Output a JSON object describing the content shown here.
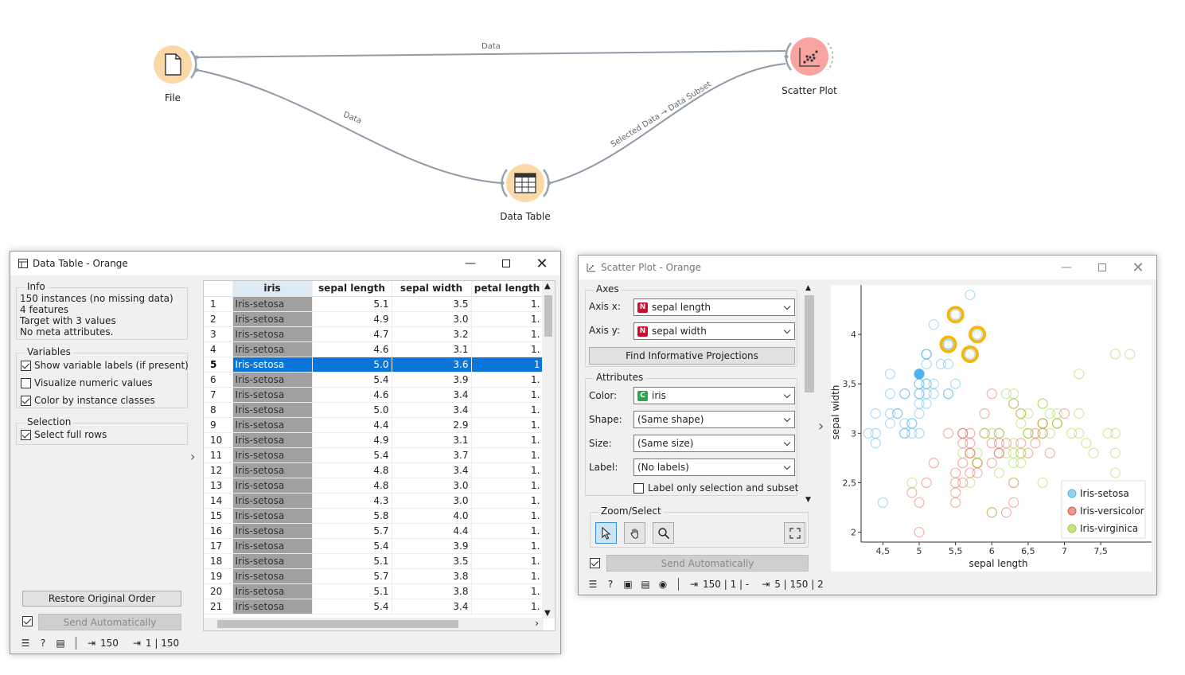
{
  "canvas": {
    "nodes": {
      "file": {
        "label": "File"
      },
      "scatter": {
        "label": "Scatter Plot"
      },
      "datatable": {
        "label": "Data Table"
      }
    },
    "links": {
      "file_scatter": "Data",
      "file_table": "Data",
      "table_scatter": "Selected Data → Data Subset"
    }
  },
  "datatable_window": {
    "title": "Data Table - Orange",
    "info": {
      "title": "Info",
      "lines": [
        "150 instances (no missing data)",
        "4 features",
        "Target with 3 values",
        "No meta attributes."
      ]
    },
    "variables": {
      "title": "Variables",
      "options": [
        {
          "label": "Show variable labels (if present)",
          "checked": true
        },
        {
          "label": "Visualize numeric values",
          "checked": false
        },
        {
          "label": "Color by instance classes",
          "checked": true
        }
      ]
    },
    "selection": {
      "title": "Selection",
      "options": [
        {
          "label": "Select full rows",
          "checked": true
        }
      ]
    },
    "restore_button": "Restore Original Order",
    "send_auto_button": "Send Automatically",
    "table": {
      "headers": [
        "iris",
        "sepal length",
        "sepal width",
        "petal length"
      ],
      "selected_row": 5,
      "rows": [
        [
          "1",
          "Iris-setosa",
          "5.1",
          "3.5",
          "1."
        ],
        [
          "2",
          "Iris-setosa",
          "4.9",
          "3.0",
          "1."
        ],
        [
          "3",
          "Iris-setosa",
          "4.7",
          "3.2",
          "1."
        ],
        [
          "4",
          "Iris-setosa",
          "4.6",
          "3.1",
          "1."
        ],
        [
          "5",
          "Iris-setosa",
          "5.0",
          "3.6",
          "1"
        ],
        [
          "6",
          "Iris-setosa",
          "5.4",
          "3.9",
          "1."
        ],
        [
          "7",
          "Iris-setosa",
          "4.6",
          "3.4",
          "1."
        ],
        [
          "8",
          "Iris-setosa",
          "5.0",
          "3.4",
          "1."
        ],
        [
          "9",
          "Iris-setosa",
          "4.4",
          "2.9",
          "1."
        ],
        [
          "10",
          "Iris-setosa",
          "4.9",
          "3.1",
          "1."
        ],
        [
          "11",
          "Iris-setosa",
          "5.4",
          "3.7",
          "1."
        ],
        [
          "12",
          "Iris-setosa",
          "4.8",
          "3.4",
          "1."
        ],
        [
          "13",
          "Iris-setosa",
          "4.8",
          "3.0",
          "1."
        ],
        [
          "14",
          "Iris-setosa",
          "4.3",
          "3.0",
          "1."
        ],
        [
          "15",
          "Iris-setosa",
          "5.8",
          "4.0",
          "1."
        ],
        [
          "16",
          "Iris-setosa",
          "5.7",
          "4.4",
          "1."
        ],
        [
          "17",
          "Iris-setosa",
          "5.4",
          "3.9",
          "1."
        ],
        [
          "18",
          "Iris-setosa",
          "5.1",
          "3.5",
          "1."
        ],
        [
          "19",
          "Iris-setosa",
          "5.7",
          "3.8",
          "1."
        ],
        [
          "20",
          "Iris-setosa",
          "5.1",
          "3.8",
          "1."
        ],
        [
          "21",
          "Iris-setosa",
          "5.4",
          "3.4",
          "1."
        ]
      ]
    },
    "status": {
      "input": "150",
      "output": "1 | 150"
    }
  },
  "scatter_window": {
    "title": "Scatter Plot - Orange",
    "axes": {
      "title": "Axes",
      "x_label": "Axis x:",
      "x_value": "sepal length",
      "y_label": "Axis y:",
      "y_value": "sepal width",
      "find_button": "Find Informative Projections"
    },
    "attributes": {
      "title": "Attributes",
      "color_label": "Color:",
      "color_value": "iris",
      "shape_label": "Shape:",
      "shape_value": "(Same shape)",
      "size_label": "Size:",
      "size_value": "(Same size)",
      "label_label": "Label:",
      "label_value": "(No labels)",
      "label_only": "Label only selection and subset"
    },
    "zoom": {
      "title": "Zoom/Select"
    },
    "send_auto_button": "Send Automatically",
    "status": {
      "input": "150 | 1 | -",
      "output": "5 | 150 | 2"
    },
    "colors": {
      "setosa": "#4fb3ec",
      "versicolor": "#e0554b",
      "virginica": "#9ed033",
      "subset": "#f5b50f"
    }
  },
  "chart_data": {
    "type": "scatter",
    "xlabel": "sepal length",
    "ylabel": "sepal width",
    "xlim": [
      4.2,
      8.2
    ],
    "ylim": [
      1.9,
      4.5
    ],
    "xticks": [
      "4,5",
      "5",
      "5,5",
      "6",
      "6,5",
      "7",
      "7,5"
    ],
    "xtick_values": [
      4.5,
      5,
      5.5,
      6,
      6.5,
      7,
      7.5
    ],
    "yticks": [
      "2",
      "2,5",
      "3",
      "3,5",
      "4"
    ],
    "ytick_values": [
      2,
      2.5,
      3,
      3.5,
      4
    ],
    "legend": [
      "Iris-setosa",
      "Iris-versicolor",
      "Iris-virginica"
    ],
    "legend_position": "bottom-right",
    "selected_point": [
      5.0,
      3.6
    ],
    "subset_points": [
      [
        5.5,
        4.2
      ],
      [
        5.8,
        4.0
      ],
      [
        5.4,
        3.9
      ],
      [
        5.7,
        3.8
      ]
    ],
    "series": [
      {
        "name": "Iris-setosa",
        "points": [
          [
            5.1,
            3.5
          ],
          [
            4.9,
            3.0
          ],
          [
            4.7,
            3.2
          ],
          [
            4.6,
            3.1
          ],
          [
            5.0,
            3.6
          ],
          [
            5.4,
            3.9
          ],
          [
            4.6,
            3.4
          ],
          [
            5.0,
            3.4
          ],
          [
            4.4,
            2.9
          ],
          [
            4.9,
            3.1
          ],
          [
            5.4,
            3.7
          ],
          [
            4.8,
            3.4
          ],
          [
            4.8,
            3.0
          ],
          [
            4.3,
            3.0
          ],
          [
            5.8,
            4.0
          ],
          [
            5.7,
            4.4
          ],
          [
            5.4,
            3.9
          ],
          [
            5.1,
            3.5
          ],
          [
            5.7,
            3.8
          ],
          [
            5.1,
            3.8
          ],
          [
            5.4,
            3.4
          ],
          [
            5.1,
            3.7
          ],
          [
            4.6,
            3.6
          ],
          [
            5.1,
            3.3
          ],
          [
            4.8,
            3.4
          ],
          [
            5.0,
            3.0
          ],
          [
            5.0,
            3.4
          ],
          [
            5.2,
            3.5
          ],
          [
            5.2,
            3.4
          ],
          [
            4.7,
            3.2
          ],
          [
            4.8,
            3.1
          ],
          [
            5.4,
            3.4
          ],
          [
            5.2,
            4.1
          ],
          [
            5.5,
            4.2
          ],
          [
            4.9,
            3.1
          ],
          [
            5.0,
            3.2
          ],
          [
            5.5,
            3.5
          ],
          [
            4.4,
            3.0
          ],
          [
            5.1,
            3.4
          ],
          [
            5.0,
            3.5
          ],
          [
            4.5,
            2.3
          ],
          [
            4.4,
            3.2
          ],
          [
            5.0,
            3.5
          ],
          [
            5.1,
            3.8
          ],
          [
            4.8,
            3.0
          ],
          [
            5.1,
            3.8
          ],
          [
            4.6,
            3.2
          ],
          [
            5.3,
            3.7
          ],
          [
            5.0,
            3.3
          ]
        ]
      },
      {
        "name": "Iris-versicolor",
        "points": [
          [
            7.0,
            3.2
          ],
          [
            6.4,
            3.2
          ],
          [
            6.9,
            3.1
          ],
          [
            5.5,
            2.3
          ],
          [
            6.5,
            2.8
          ],
          [
            5.7,
            2.8
          ],
          [
            6.3,
            3.3
          ],
          [
            4.9,
            2.4
          ],
          [
            6.6,
            2.9
          ],
          [
            5.2,
            2.7
          ],
          [
            5.0,
            2.0
          ],
          [
            5.9,
            3.0
          ],
          [
            6.0,
            2.2
          ],
          [
            6.1,
            2.9
          ],
          [
            5.6,
            2.9
          ],
          [
            6.7,
            3.1
          ],
          [
            5.6,
            3.0
          ],
          [
            5.8,
            2.7
          ],
          [
            6.2,
            2.2
          ],
          [
            5.6,
            2.5
          ],
          [
            5.9,
            3.2
          ],
          [
            6.1,
            2.8
          ],
          [
            6.3,
            2.5
          ],
          [
            6.1,
            2.8
          ],
          [
            6.4,
            2.9
          ],
          [
            6.6,
            3.0
          ],
          [
            6.8,
            2.8
          ],
          [
            6.7,
            3.0
          ],
          [
            6.0,
            2.9
          ],
          [
            5.7,
            2.6
          ],
          [
            5.5,
            2.4
          ],
          [
            5.8,
            2.7
          ],
          [
            6.0,
            2.7
          ],
          [
            5.4,
            3.0
          ],
          [
            6.0,
            3.4
          ],
          [
            6.7,
            3.1
          ],
          [
            6.3,
            2.3
          ],
          [
            5.6,
            3.0
          ],
          [
            5.5,
            2.5
          ],
          [
            5.5,
            2.6
          ],
          [
            6.1,
            3.0
          ],
          [
            5.8,
            2.6
          ],
          [
            5.0,
            2.3
          ],
          [
            5.6,
            2.7
          ],
          [
            5.7,
            3.0
          ],
          [
            5.7,
            2.9
          ],
          [
            6.2,
            2.9
          ],
          [
            5.1,
            2.5
          ],
          [
            5.7,
            2.8
          ]
        ]
      },
      {
        "name": "Iris-virginica",
        "points": [
          [
            6.3,
            3.3
          ],
          [
            5.8,
            2.7
          ],
          [
            7.1,
            3.0
          ],
          [
            6.3,
            2.9
          ],
          [
            6.5,
            3.0
          ],
          [
            7.6,
            3.0
          ],
          [
            4.9,
            2.5
          ],
          [
            7.3,
            2.9
          ],
          [
            6.7,
            2.5
          ],
          [
            7.2,
            3.6
          ],
          [
            6.5,
            3.2
          ],
          [
            6.4,
            2.7
          ],
          [
            6.8,
            3.0
          ],
          [
            5.7,
            2.5
          ],
          [
            5.8,
            2.8
          ],
          [
            6.4,
            3.2
          ],
          [
            6.5,
            3.0
          ],
          [
            7.7,
            3.8
          ],
          [
            7.7,
            2.6
          ],
          [
            6.0,
            2.2
          ],
          [
            6.9,
            3.2
          ],
          [
            5.6,
            2.8
          ],
          [
            7.7,
            2.8
          ],
          [
            6.3,
            2.7
          ],
          [
            6.7,
            3.3
          ],
          [
            7.2,
            3.2
          ],
          [
            6.2,
            2.8
          ],
          [
            6.1,
            3.0
          ],
          [
            6.4,
            2.8
          ],
          [
            7.2,
            3.0
          ],
          [
            7.4,
            2.8
          ],
          [
            7.9,
            3.8
          ],
          [
            6.4,
            2.8
          ],
          [
            6.3,
            2.8
          ],
          [
            6.1,
            2.6
          ],
          [
            7.7,
            3.0
          ],
          [
            6.3,
            3.4
          ],
          [
            6.4,
            3.1
          ],
          [
            6.0,
            3.0
          ],
          [
            6.9,
            3.1
          ],
          [
            6.7,
            3.1
          ],
          [
            6.9,
            3.1
          ],
          [
            5.8,
            2.7
          ],
          [
            6.8,
            3.2
          ],
          [
            6.7,
            3.3
          ],
          [
            6.7,
            3.0
          ],
          [
            6.3,
            2.5
          ],
          [
            6.5,
            3.0
          ],
          [
            6.2,
            3.4
          ],
          [
            5.9,
            3.0
          ]
        ]
      }
    ]
  }
}
